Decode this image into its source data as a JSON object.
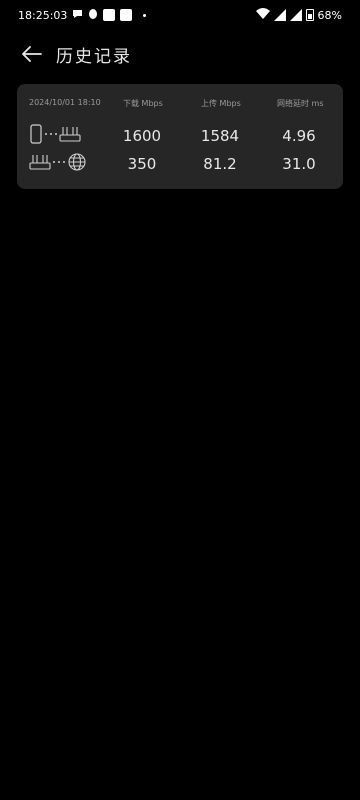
{
  "status_bar": {
    "time": "18:25:03",
    "battery": "68%"
  },
  "header": {
    "title": "历史记录"
  },
  "record": {
    "timestamp": "2024/10/01 18:10",
    "columns": [
      "下载 Mbps",
      "上传 Mbps",
      "网络延时 ms"
    ],
    "rows": [
      {
        "icons": [
          "phone-icon",
          "router-icon"
        ],
        "download": "1600",
        "upload": "1584",
        "latency": "4.96"
      },
      {
        "icons": [
          "router-icon",
          "globe-icon"
        ],
        "download": "350",
        "upload": "81.2",
        "latency": "31.0"
      }
    ]
  }
}
